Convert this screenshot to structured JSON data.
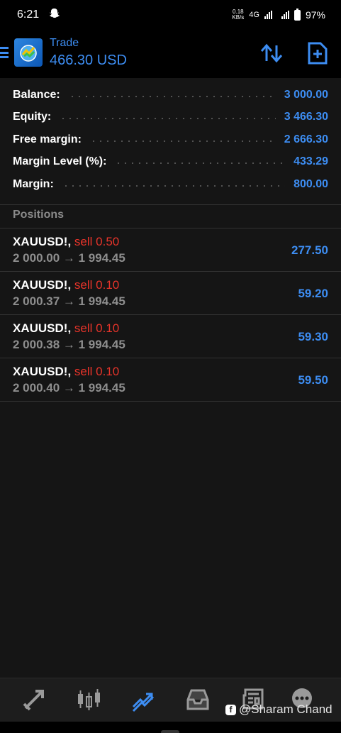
{
  "status_bar": {
    "time": "6:21",
    "net_speed_value": "0.18",
    "net_speed_unit": "KB/s",
    "network": "4G",
    "battery": "97%"
  },
  "header": {
    "title": "Trade",
    "balance": "466.30 USD"
  },
  "summary": [
    {
      "label": "Balance:",
      "value": "3 000.00"
    },
    {
      "label": "Equity:",
      "value": "3 466.30"
    },
    {
      "label": "Free margin:",
      "value": "2 666.30"
    },
    {
      "label": "Margin Level (%):",
      "value": "433.29"
    },
    {
      "label": "Margin:",
      "value": "800.00"
    }
  ],
  "positions_title": "Positions",
  "positions": [
    {
      "symbol": "XAUUSD!,",
      "type": "sell 0.50",
      "prices": "2 000.00 → 1 994.45",
      "profit": "277.50"
    },
    {
      "symbol": "XAUUSD!,",
      "type": "sell 0.10",
      "prices": "2 000.37 → 1 994.45",
      "profit": "59.20"
    },
    {
      "symbol": "XAUUSD!,",
      "type": "sell 0.10",
      "prices": "2 000.38 → 1 994.45",
      "profit": "59.30"
    },
    {
      "symbol": "XAUUSD!,",
      "type": "sell 0.10",
      "prices": "2 000.40 → 1 994.45",
      "profit": "59.50"
    }
  ],
  "bottom_nav": [
    "quotes-icon",
    "chart-icon",
    "trade-icon",
    "history-icon",
    "news-icon",
    "chat-icon"
  ],
  "watermark": "@Sharam Chand",
  "colors": {
    "accent": "#3d8df2",
    "sell": "#e8342a",
    "background": "#151515"
  }
}
